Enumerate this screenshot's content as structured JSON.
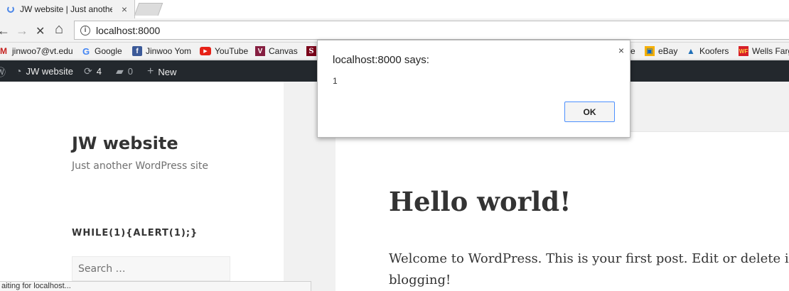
{
  "browser": {
    "tab_title": "JW website | Just another",
    "tab_close": "×",
    "url": "localhost:8000",
    "back": "←",
    "forward": "→",
    "stop": "✕",
    "home": "⌂"
  },
  "bookmarks": [
    {
      "label": "jinwoo7@vt.edu",
      "icon": "gmail-icon",
      "color": "#c5221f"
    },
    {
      "label": "Google",
      "icon": "google-icon",
      "color": "#4285f4"
    },
    {
      "label": "Jinwoo Yom",
      "icon": "facebook-icon",
      "color": "#3b5998"
    },
    {
      "label": "YouTube",
      "icon": "youtube-icon",
      "color": "#e62117"
    },
    {
      "label": "Canvas",
      "icon": "canvas-icon",
      "color": "#861f41"
    },
    {
      "label": "e",
      "icon": "generic-icon",
      "color": "#888888"
    },
    {
      "label": "eBay",
      "icon": "ebay-icon",
      "color": "#e53238"
    },
    {
      "label": "Koofers",
      "icon": "koofers-icon",
      "color": "#1e6fb8"
    },
    {
      "label": "Wells Farg",
      "icon": "wellsfargo-icon",
      "color": "#d71e28"
    }
  ],
  "adminbar": {
    "site": "JW website",
    "updates": "4",
    "comments": "0",
    "new": "New"
  },
  "site": {
    "title": "JW website",
    "description": "Just another WordPress site"
  },
  "widget": {
    "title": "WHILE(1){ALERT(1);}",
    "search_placeholder": "Search …"
  },
  "post": {
    "title": "Hello world!",
    "body_line1": "Welcome to WordPress. This is your first post. Edit or delete it, then st",
    "body_line2": "blogging!"
  },
  "status": "aiting for localhost...",
  "dialog": {
    "title": "localhost:8000 says:",
    "message": "1",
    "ok": "OK",
    "close": "×"
  }
}
